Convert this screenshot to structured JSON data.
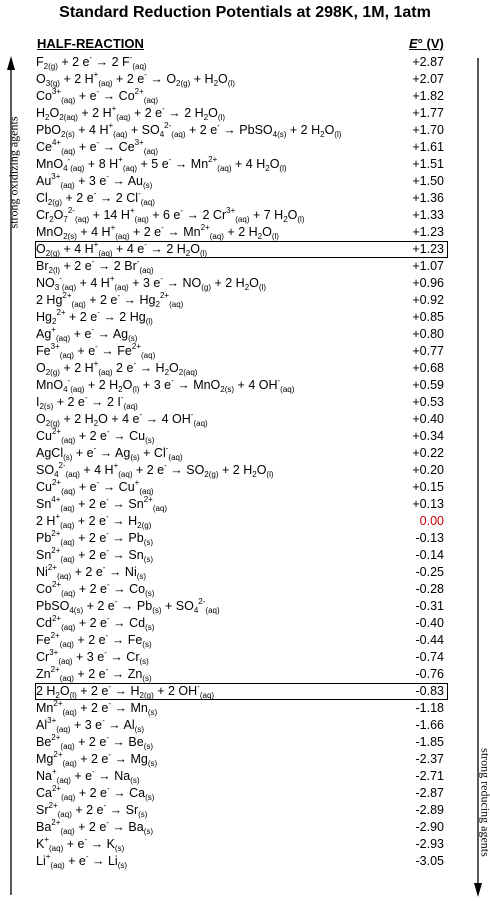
{
  "title": "Standard Reduction Potentials at 298K, 1M, 1atm",
  "header": {
    "half_reaction": "HALF-REACTION",
    "e_symbol": "E",
    "e_super": "°",
    "e_unit": "(V)"
  },
  "side_labels": {
    "left": "strong oxidizing agents",
    "right": "strong reducing agents"
  },
  "rows": [
    {
      "html": "F<sub>2(g)</sub> + 2 e<sup>-</sup> → 2 F<sup>-</sup><sub>(aq)</sub>",
      "e": "+2.87"
    },
    {
      "html": "O<sub>3(g)</sub> + 2 H<sup>+</sup><sub>(aq)</sub> + 2 e<sup>-</sup> → O<sub>2(g)</sub> + H<sub>2</sub>O<sub>(l)</sub>",
      "e": "+2.07"
    },
    {
      "html": "Co<sup>3+</sup><sub>(aq)</sub> + e<sup>-</sup> → Co<sup>2+</sup><sub>(aq)</sub>",
      "e": "+1.82"
    },
    {
      "html": "H<sub>2</sub>O<sub>2(aq)</sub> + 2 H<sup>+</sup><sub>(aq)</sub> + 2 e<sup>-</sup> → 2 H<sub>2</sub>O<sub>(l)</sub>",
      "e": "+1.77"
    },
    {
      "html": "PbO<sub>2(s)</sub> + 4 H<sup>+</sup><sub>(aq)</sub> + SO<sub>4</sub><sup>2-</sup><sub>(aq)</sub> + 2 e<sup>-</sup> → PbSO<sub>4(s)</sub> + 2 H<sub>2</sub>O<sub>(l)</sub>",
      "e": "+1.70"
    },
    {
      "html": "Ce<sup>4+</sup><sub>(aq)</sub> + e<sup>-</sup> → Ce<sup>3+</sup><sub>(aq)</sub>",
      "e": "+1.61"
    },
    {
      "html": "MnO<sub>4</sub><sup>-</sup><sub>(aq)</sub> + 8 H<sup>+</sup><sub>(aq)</sub> + 5 e<sup>-</sup> → Mn<sup>2+</sup><sub>(aq)</sub> + 4 H<sub>2</sub>O<sub>(l)</sub>",
      "e": "+1.51"
    },
    {
      "html": "Au<sup>3+</sup><sub>(aq)</sub> + 3 e<sup>-</sup> → Au<sub>(s)</sub>",
      "e": "+1.50"
    },
    {
      "html": "Cl<sub>2(g)</sub> + 2 e<sup>-</sup> → 2 Cl<sup>-</sup><sub>(aq)</sub>",
      "e": "+1.36"
    },
    {
      "html": "Cr<sub>2</sub>O<sub>7</sub><sup>2-</sup><sub>(aq)</sub> + 14 H<sup>+</sup><sub>(aq)</sub> + 6 e<sup>-</sup> → 2 Cr<sup>3+</sup><sub>(aq)</sub> + 7 H<sub>2</sub>O<sub>(l)</sub>",
      "e": "+1.33"
    },
    {
      "html": "MnO<sub>2(s)</sub> + 4 H<sup>+</sup><sub>(aq)</sub> + 2 e<sup>-</sup> → Mn<sup>2+</sup><sub>(aq)</sub> + 2 H<sub>2</sub>O<sub>(l)</sub>",
      "e": "+1.23"
    },
    {
      "html": "O<sub>2(g)</sub> + 4 H<sup>+</sup><sub>(aq)</sub> + 4 e<sup>-</sup> → 2 H<sub>2</sub>O<sub>(l)</sub>",
      "e": "+1.23",
      "boxed": true
    },
    {
      "html": "Br<sub>2(l)</sub> + 2 e<sup>-</sup> → 2 Br<sup>-</sup><sub>(aq)</sub>",
      "e": "+1.07"
    },
    {
      "html": "NO<sub>3</sub><sup>-</sup><sub>(aq)</sub> + 4 H<sup>+</sup><sub>(aq)</sub> + 3 e<sup>-</sup> → NO<sub>(g)</sub> + 2 H<sub>2</sub>O<sub>(l)</sub>",
      "e": "+0.96"
    },
    {
      "html": "2 Hg<sup>2+</sup><sub>(aq)</sub> + 2 e<sup>-</sup> → Hg<sub>2</sub><sup>2+</sup><sub>(aq)</sub>",
      "e": "+0.92"
    },
    {
      "html": "Hg<sub>2</sub><sup>2+</sup> + 2 e<sup>-</sup> → 2 Hg<sub>(l)</sub>",
      "e": "+0.85"
    },
    {
      "html": "Ag<sup>+</sup><sub>(aq)</sub> + e<sup>-</sup> → Ag<sub>(s)</sub>",
      "e": "+0.80"
    },
    {
      "html": "Fe<sup>3+</sup><sub>(aq)</sub> + e<sup>-</sup> → Fe<sup>2+</sup><sub>(aq)</sub>",
      "e": "+0.77"
    },
    {
      "html": "O<sub>2(g)</sub> + 2 H<sup>+</sup><sub>(aq)</sub> 2 e<sup>-</sup> → H<sub>2</sub>O<sub>2(aq)</sub>",
      "e": "+0.68"
    },
    {
      "html": "MnO<sub>4</sub><sup>-</sup><sub>(aq)</sub> + 2 H<sub>2</sub>O<sub>(l)</sub> + 3 e<sup>-</sup> → MnO<sub>2(s)</sub> + 4 OH<sup>-</sup><sub>(aq)</sub>",
      "e": "+0.59"
    },
    {
      "html": "I<sub>2(s)</sub> + 2 e<sup>-</sup> → 2 I<sup>-</sup><sub>(aq)</sub>",
      "e": "+0.53"
    },
    {
      "html": "O<sub>2(g)</sub> + 2 H<sub>2</sub>O + 4 e<sup>-</sup> → 4 OH<sup>-</sup><sub>(aq)</sub>",
      "e": "+0.40"
    },
    {
      "html": "Cu<sup>2+</sup><sub>(aq)</sub> + 2 e<sup>-</sup> → Cu<sub>(s)</sub>",
      "e": "+0.34"
    },
    {
      "html": "AgCl<sub>(s)</sub> + e<sup>-</sup> → Ag<sub>(s)</sub> + Cl<sup>-</sup><sub>(aq)</sub>",
      "e": "+0.22"
    },
    {
      "html": "SO<sub>4</sub><sup>2-</sup><sub>(aq)</sub> + 4 H<sup>+</sup><sub>(aq)</sub> + 2 e<sup>-</sup> → SO<sub>2(g)</sub> + 2 H<sub>2</sub>O<sub>(l)</sub>",
      "e": "+0.20"
    },
    {
      "html": "Cu<sup>2+</sup><sub>(aq)</sub> + e<sup>-</sup> → Cu<sup>+</sup><sub>(aq)</sub>",
      "e": "+0.15"
    },
    {
      "html": "Sn<sup>4+</sup><sub>(aq)</sub> + 2 e<sup>-</sup> → Sn<sup>2+</sup><sub>(aq)</sub>",
      "e": "+0.13"
    },
    {
      "html": "2 H<sup>+</sup><sub>(aq)</sub> + 2 e<sup>-</sup> → H<sub>2(g)</sub>",
      "e": "0.00",
      "red": true
    },
    {
      "html": "Pb<sup>2+</sup><sub>(aq)</sub> + 2 e<sup>-</sup> → Pb<sub>(s)</sub>",
      "e": "-0.13"
    },
    {
      "html": "Sn<sup>2+</sup><sub>(aq)</sub> + 2 e<sup>-</sup> → Sn<sub>(s)</sub>",
      "e": "-0.14"
    },
    {
      "html": "Ni<sup>2+</sup><sub>(aq)</sub> + 2 e<sup>-</sup> → Ni<sub>(s)</sub>",
      "e": "-0.25"
    },
    {
      "html": "Co<sup>2+</sup><sub>(aq)</sub> + 2 e<sup>-</sup> → Co<sub>(s)</sub>",
      "e": "-0.28"
    },
    {
      "html": "PbSO<sub>4(s)</sub> + 2 e<sup>-</sup> → Pb<sub>(s)</sub> + SO<sub>4</sub><sup>2-</sup><sub>(aq)</sub>",
      "e": "-0.31"
    },
    {
      "html": "Cd<sup>2+</sup><sub>(aq)</sub> + 2 e<sup>-</sup> → Cd<sub>(s)</sub>",
      "e": "-0.40"
    },
    {
      "html": "Fe<sup>2+</sup><sub>(aq)</sub> + 2 e<sup>-</sup> → Fe<sub>(s)</sub>",
      "e": "-0.44"
    },
    {
      "html": "Cr<sup>3+</sup><sub>(aq)</sub> + 3 e<sup>-</sup> → Cr<sub>(s)</sub>",
      "e": "-0.74"
    },
    {
      "html": "Zn<sup>2+</sup><sub>(aq)</sub> + 2 e<sup>-</sup> → Zn<sub>(s)</sub>",
      "e": "-0.76"
    },
    {
      "html": "2 H<sub>2</sub>O<sub>(l)</sub> + 2 e<sup>-</sup> → H<sub>2(g)</sub> + 2 OH<sup>-</sup><sub>(aq)</sub>",
      "e": "-0.83",
      "boxed": true
    },
    {
      "html": "Mn<sup>2+</sup><sub>(aq)</sub> + 2 e<sup>-</sup> → Mn<sub>(s)</sub>",
      "e": "-1.18"
    },
    {
      "html": "Al<sup>3+</sup><sub>(aq)</sub> + 3 e<sup>-</sup> → Al<sub>(s)</sub>",
      "e": "-1.66"
    },
    {
      "html": "Be<sup>2+</sup><sub>(aq)</sub> + 2 e<sup>-</sup> → Be<sub>(s)</sub>",
      "e": "-1.85"
    },
    {
      "html": "Mg<sup>2+</sup><sub>(aq)</sub> + 2 e<sup>-</sup> → Mg<sub>(s)</sub>",
      "e": "-2.37"
    },
    {
      "html": "Na<sup>+</sup><sub>(aq)</sub> + e<sup>-</sup> → Na<sub>(s)</sub>",
      "e": "-2.71"
    },
    {
      "html": "Ca<sup>2+</sup><sub>(aq)</sub> + 2 e<sup>-</sup> → Ca<sub>(s)</sub>",
      "e": "-2.87"
    },
    {
      "html": "Sr<sup>2+</sup><sub>(aq)</sub> + 2 e<sup>-</sup> → Sr<sub>(s)</sub>",
      "e": "-2.89"
    },
    {
      "html": "Ba<sup>2+</sup><sub>(aq)</sub> + 2 e<sup>-</sup> → Ba<sub>(s)</sub>",
      "e": "-2.90"
    },
    {
      "html": "K<sup>+</sup><sub>(aq)</sub> + e<sup>-</sup> → K<sub>(s)</sub>",
      "e": "-2.93"
    },
    {
      "html": "Li<sup>+</sup><sub>(aq)</sub> + e<sup>-</sup> → Li<sub>(s)</sub>",
      "e": "-3.05"
    }
  ]
}
